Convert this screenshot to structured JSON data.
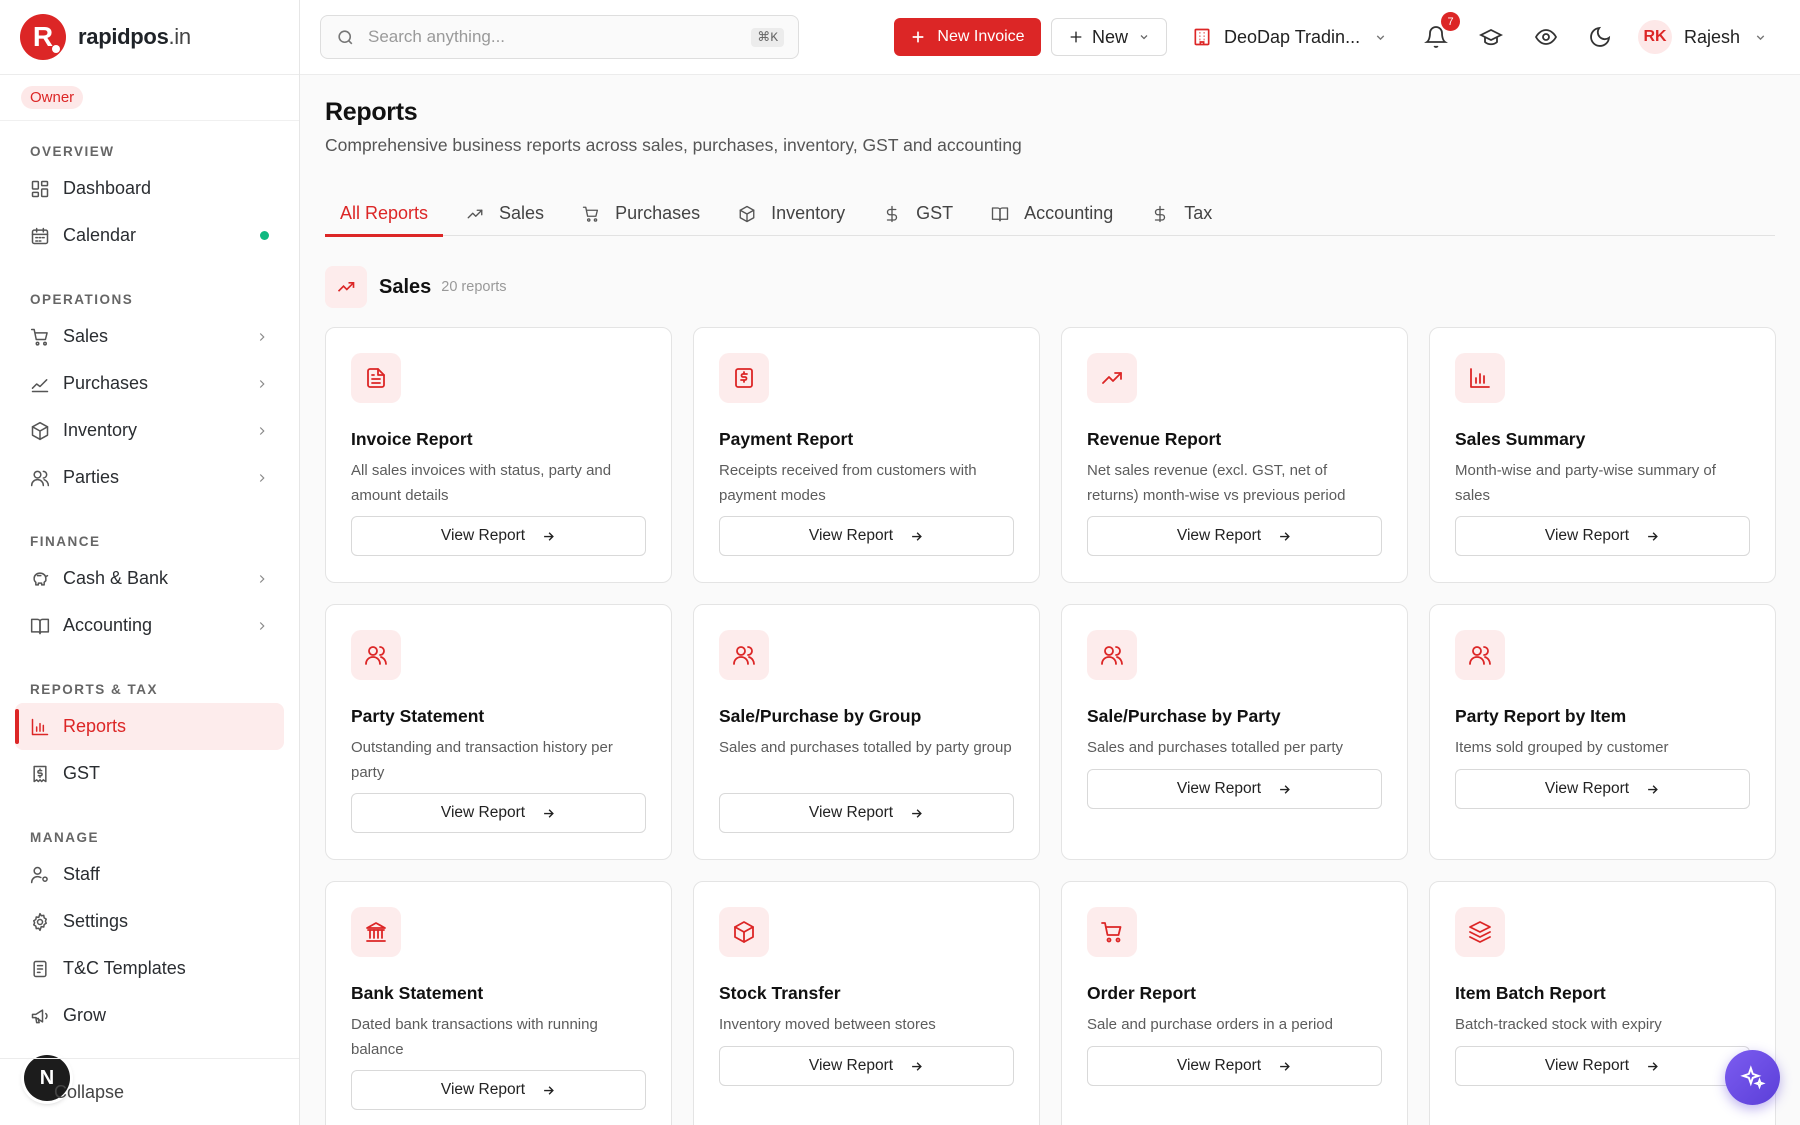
{
  "brand": {
    "name": "rapidpos",
    "tld": ".in",
    "logo_letter": "R"
  },
  "role": "Owner",
  "sidebar": {
    "sections": [
      {
        "title": "OVERVIEW",
        "items": [
          {
            "label": "Dashboard",
            "icon": "dashboard-icon",
            "dot": false,
            "chevron": false
          },
          {
            "label": "Calendar",
            "icon": "calendar-icon",
            "dot": true,
            "chevron": false
          }
        ]
      },
      {
        "title": "OPERATIONS",
        "items": [
          {
            "label": "Sales",
            "icon": "cart-icon",
            "chevron": true
          },
          {
            "label": "Purchases",
            "icon": "trend-icon",
            "chevron": true
          },
          {
            "label": "Inventory",
            "icon": "box-icon",
            "chevron": true
          },
          {
            "label": "Parties",
            "icon": "users-icon",
            "chevron": true
          }
        ]
      },
      {
        "title": "FINANCE",
        "items": [
          {
            "label": "Cash & Bank",
            "icon": "piggy-bank-icon",
            "chevron": true
          },
          {
            "label": "Accounting",
            "icon": "book-icon",
            "chevron": true
          }
        ]
      },
      {
        "title": "REPORTS & TAX",
        "items": [
          {
            "label": "Reports",
            "icon": "bar-chart-icon",
            "active": true
          },
          {
            "label": "GST",
            "icon": "receipt-icon"
          }
        ]
      },
      {
        "title": "MANAGE",
        "items": [
          {
            "label": "Staff",
            "icon": "user-cog-icon"
          },
          {
            "label": "Settings",
            "icon": "gear-icon"
          },
          {
            "label": "T&C Templates",
            "icon": "document-icon"
          },
          {
            "label": "Grow",
            "icon": "megaphone-icon"
          }
        ]
      }
    ],
    "collapse_label": "Collapse",
    "n_badge": "N"
  },
  "topbar": {
    "search_placeholder": "Search anything...",
    "search_shortcut": "⌘K",
    "new_invoice_label": "New Invoice",
    "new_label": "New",
    "company": "DeoDap Tradin...",
    "notification_count": "7",
    "user_initials": "RK",
    "user_name": "Rajesh"
  },
  "page": {
    "title": "Reports",
    "subtitle": "Comprehensive business reports across sales, purchases, inventory, GST and accounting",
    "tabs": [
      {
        "label": "All Reports",
        "icon": "",
        "active": true
      },
      {
        "label": "Sales",
        "icon": "trend-up-icon"
      },
      {
        "label": "Purchases",
        "icon": "cart-icon"
      },
      {
        "label": "Inventory",
        "icon": "box-icon"
      },
      {
        "label": "GST",
        "icon": "dollar-icon"
      },
      {
        "label": "Accounting",
        "icon": "book-icon"
      },
      {
        "label": "Tax",
        "icon": "dollar-icon"
      }
    ],
    "section": {
      "title": "Sales",
      "count": "20 reports"
    },
    "view_label": "View Report",
    "cards": [
      {
        "title": "Invoice Report",
        "desc": "All sales invoices with status, party and amount details",
        "icon": "file-text-icon",
        "lines": 2
      },
      {
        "title": "Payment Report",
        "desc": "Receipts received from customers with payment modes",
        "icon": "receipt-dollar-icon",
        "lines": 2
      },
      {
        "title": "Revenue Report",
        "desc": "Net sales revenue (excl. GST, net of returns) month-wise vs previous period",
        "icon": "trend-up-icon",
        "lines": 2
      },
      {
        "title": "Sales Summary",
        "desc": "Month-wise and party-wise summary of sales",
        "icon": "bar-chart-icon",
        "lines": 2
      },
      {
        "title": "Party Statement",
        "desc": "Outstanding and transaction history per party",
        "icon": "users-icon",
        "lines": 2
      },
      {
        "title": "Sale/Purchase by Group",
        "desc": "Sales and purchases totalled by party group",
        "icon": "users-icon",
        "lines": 2
      },
      {
        "title": "Sale/Purchase by Party",
        "desc": "Sales and purchases totalled per party",
        "icon": "users-icon",
        "lines": 1
      },
      {
        "title": "Party Report by Item",
        "desc": "Items sold grouped by customer",
        "icon": "users-icon",
        "lines": 1
      },
      {
        "title": "Bank Statement",
        "desc": "Dated bank transactions with running balance",
        "icon": "bank-icon",
        "lines": 2
      },
      {
        "title": "Stock Transfer",
        "desc": "Inventory moved between stores",
        "icon": "box-icon",
        "lines": 1
      },
      {
        "title": "Order Report",
        "desc": "Sale and purchase orders in a period",
        "icon": "cart-icon",
        "lines": 1
      },
      {
        "title": "Item Batch Report",
        "desc": "Batch-tracked stock with expiry",
        "icon": "layers-icon",
        "lines": 1
      }
    ]
  },
  "colors": {
    "accent": "#dc2626",
    "accent_soft": "#fdecec",
    "fab": "#6a4be5"
  }
}
